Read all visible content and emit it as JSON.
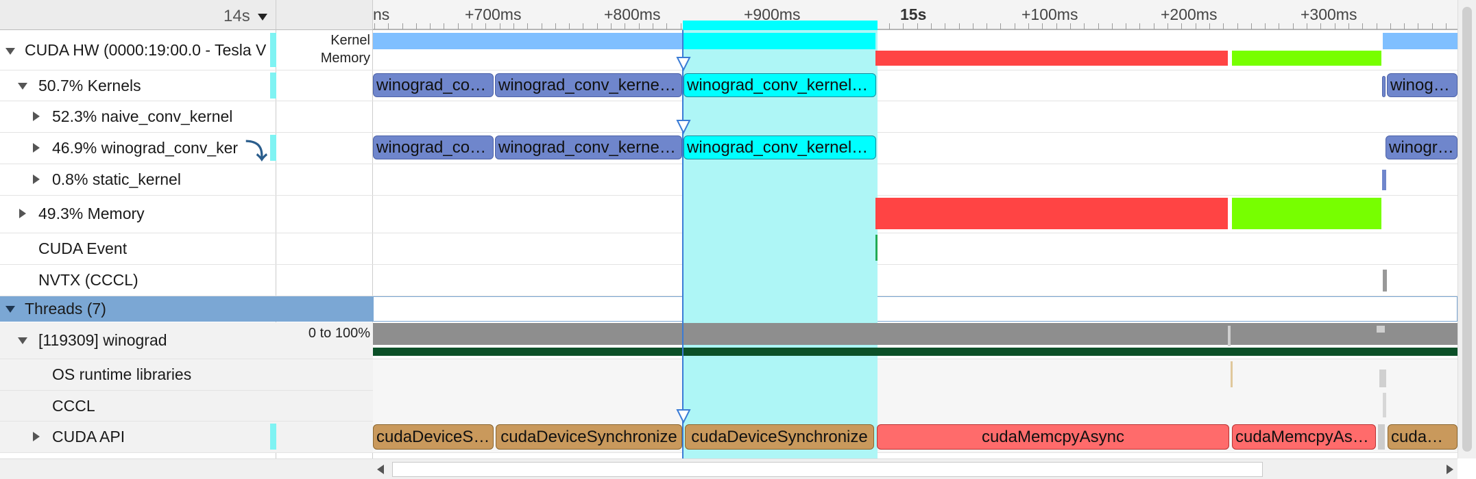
{
  "header": {
    "zoom_label": "14s",
    "ticks": [
      "ns",
      "+700ms",
      "+800ms",
      "+900ms",
      "15s",
      "+100ms",
      "+200ms",
      "+300ms"
    ]
  },
  "rows": {
    "gpu": "CUDA HW (0000:19:00.0 - Tesla V",
    "kernels": "50.7% Kernels",
    "naive": "52.3% naive_conv_kernel",
    "winograd": "46.9% winograd_conv_ker",
    "static": "0.8% static_kernel",
    "memory": "49.3% Memory",
    "event": "CUDA Event",
    "nvtx": "NVTX (CCCL)",
    "threads": "Threads (7)",
    "thread_main": "[119309] winograd",
    "os_rt": "OS runtime libraries",
    "cccl": "CCCL",
    "cuda_api": "CUDA API"
  },
  "side_labels": {
    "kernel": "Kernel",
    "memory": "Memory",
    "cpu_range": "0 to 100%"
  },
  "kernels": {
    "k1": "winograd_con…",
    "k2": "winograd_conv_kernel(…",
    "k3": "winograd_conv_kernel(c…",
    "k4": "winogr…"
  },
  "api": {
    "a1": "cudaDeviceSy…",
    "a2": "cudaDeviceSynchronize",
    "a3": "cudaDeviceSynchronize",
    "a4": "cudaMemcpyAsync",
    "a5": "cudaMemcpyAsy…",
    "a6": "cudaD…"
  },
  "colors": {
    "kernel": "#6f86cc",
    "selection": "#00ffff",
    "memcpy_htod": "#ff4444",
    "memcpy_dtoh": "#77ff00",
    "api_sync": "#c9995c",
    "api_memcpy": "#ff6b6b",
    "threads_header": "#7ba7d4"
  }
}
